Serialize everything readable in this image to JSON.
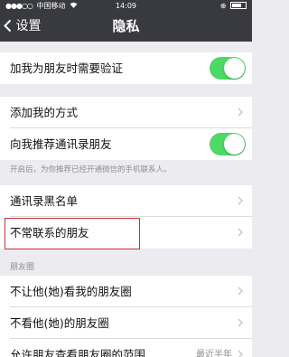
{
  "status_bar": {
    "carrier": "中国移动",
    "time": "14:09"
  },
  "nav": {
    "back_label": "设置",
    "title": "隐私"
  },
  "rows": {
    "verify": "加我为朋友时需要验证",
    "add_method": "添加我的方式",
    "recommend": "向我推荐通讯录朋友",
    "blacklist": "通讯录黑名单",
    "infrequent": "不常联系的朋友",
    "hide_from": "不让他(她)看我的朋友圈",
    "not_see": "不看他(她)的朋友圈",
    "moments_range": "允许朋友查看朋友圈的范围"
  },
  "moments_range_value": "最近半年",
  "recommend_hint": "开启后，为你推荐已经开通微信的手机联系人。",
  "moments_header": "朋友圈",
  "toggles": {
    "verify": true,
    "recommend": true
  },
  "colors": {
    "navbar": "#393a3f",
    "toggle_on": "#4cd964",
    "highlight": "#c8303a"
  }
}
